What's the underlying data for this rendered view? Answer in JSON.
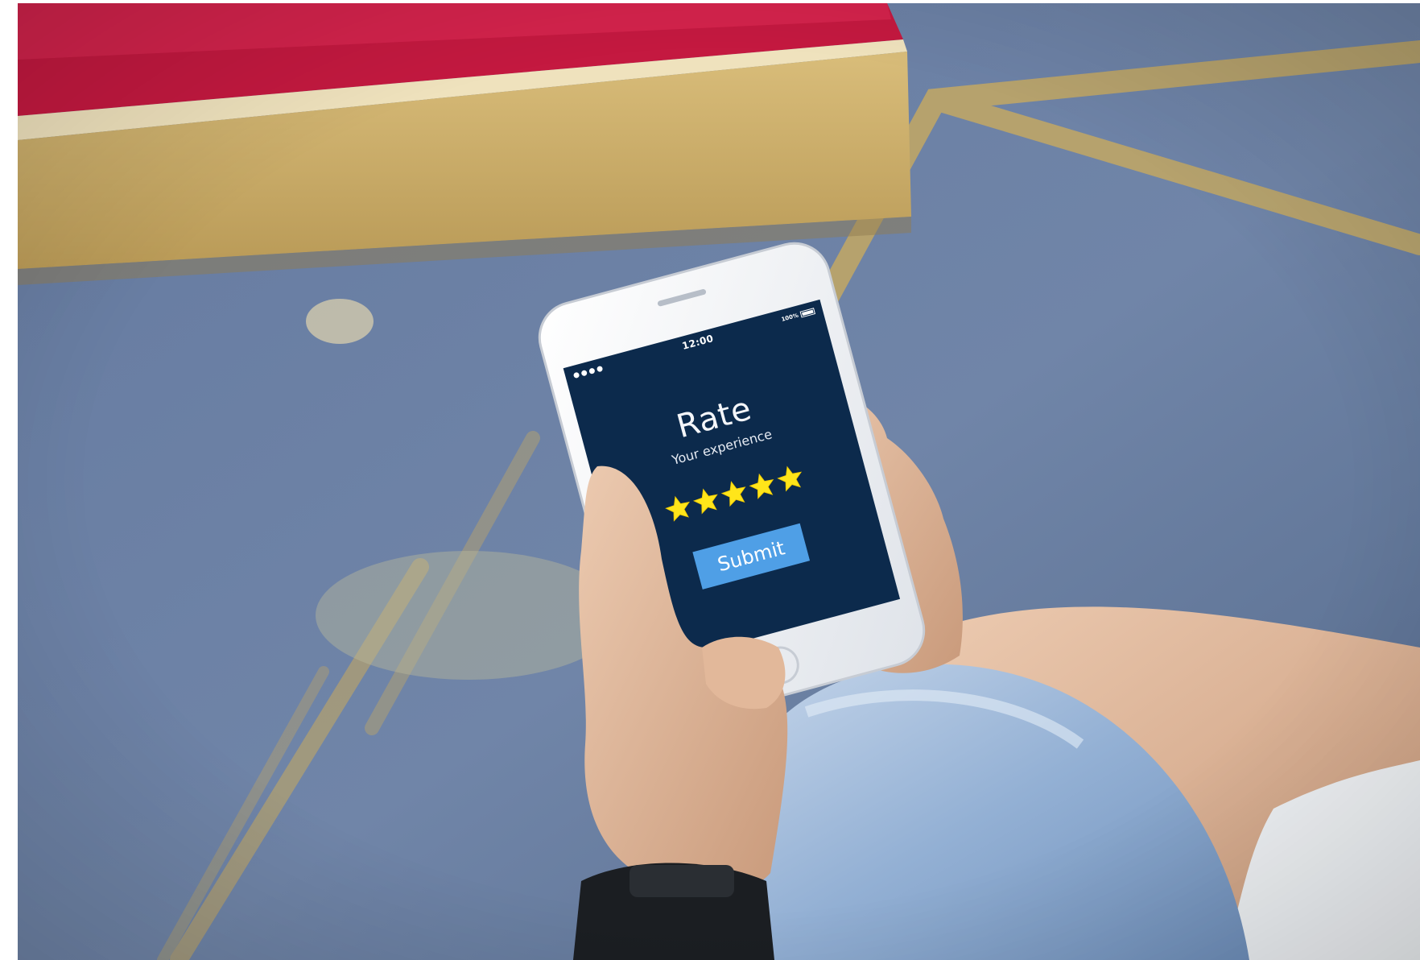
{
  "screen": {
    "status_time": "12:00",
    "battery_label": "100%",
    "title": "Rate",
    "subtitle": "Your experience",
    "rating": 5,
    "rating_max": 5,
    "submit_label": "Submit"
  },
  "colors": {
    "screen_background": "#0c2a4c",
    "star": "#ffe51a",
    "submit_button": "#4f9fe6"
  }
}
